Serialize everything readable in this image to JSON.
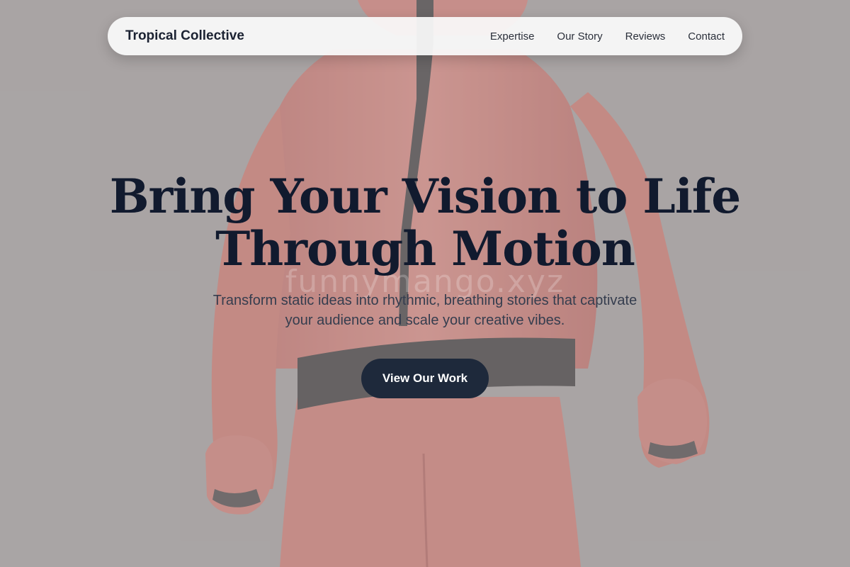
{
  "nav": {
    "brand": "Tropical Collective",
    "links": [
      "Expertise",
      "Our Story",
      "Reviews",
      "Contact"
    ]
  },
  "hero": {
    "title_line1": "Bring Your Vision to Life",
    "title_line2": "Through Motion",
    "subtitle_line1": "Transform static ideas into rhythmic, breathing stories that captivate",
    "subtitle_line2": "your audience and scale your creative vibes.",
    "cta_label": "View Our Work"
  },
  "watermark": "funnymango.xyz",
  "colors": {
    "navy": "#1e293b",
    "title": "#111a2e",
    "figure": "#d97f78",
    "background": "#a9a4a4"
  }
}
